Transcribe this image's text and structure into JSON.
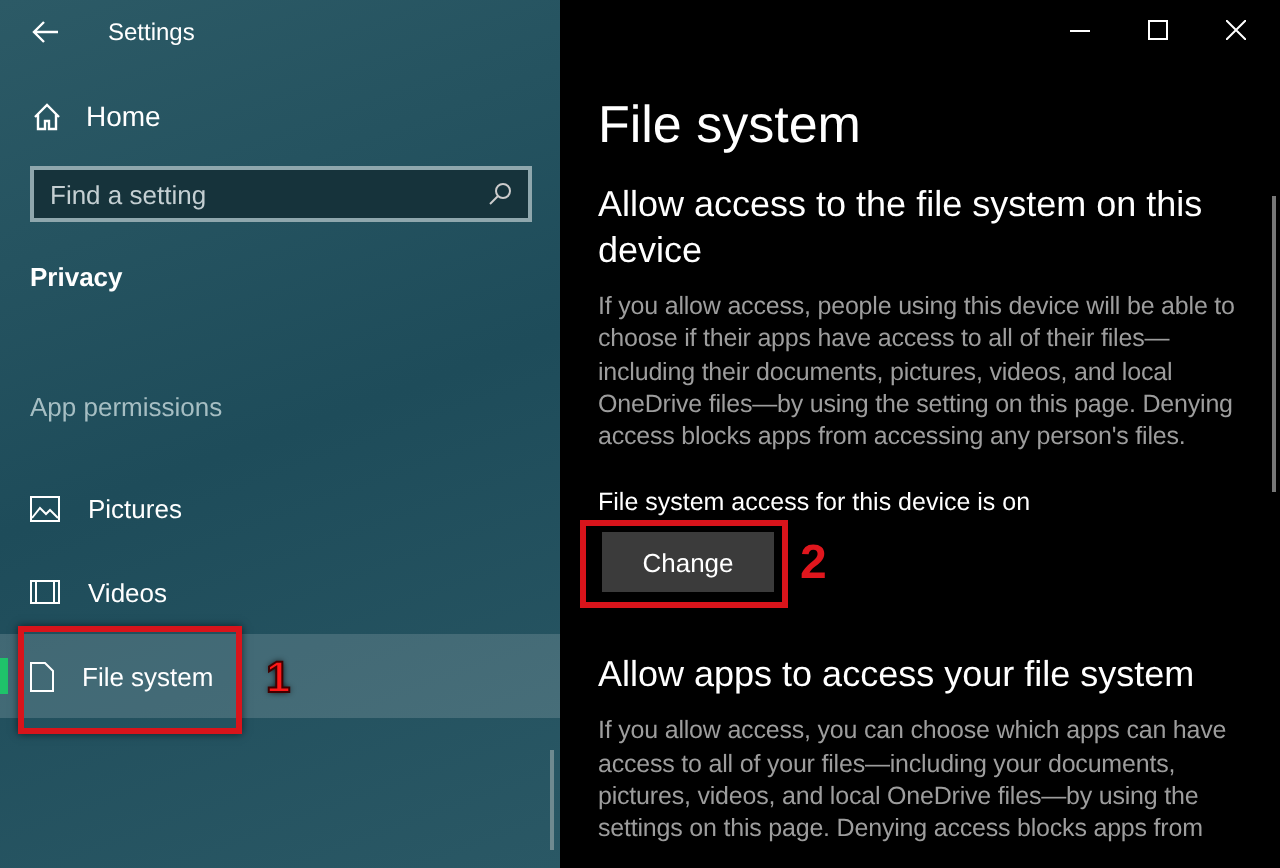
{
  "window": {
    "title": "Settings"
  },
  "sidebar": {
    "home": "Home",
    "search": {
      "placeholder": "Find a setting"
    },
    "section": "Privacy",
    "group": "App permissions",
    "items": [
      {
        "label": "Pictures",
        "kind": "pictures",
        "selected": false
      },
      {
        "label": "Videos",
        "kind": "videos",
        "selected": false
      },
      {
        "label": "File system",
        "kind": "file",
        "selected": true
      }
    ]
  },
  "page": {
    "title": "File system",
    "sections": [
      {
        "heading": "Allow access to the file system on this device",
        "text": "If you allow access, people using this device will be able to choose if their apps have access to all of their files—including their documents, pictures, videos, and local OneDrive files—by using the setting on this page. Denying access blocks apps from accessing any person's files.",
        "status": "File system access for this device is on",
        "button": "Change"
      },
      {
        "heading": "Allow apps to access your file system",
        "text": "If you allow access, you can choose which apps can have access to all of your files—including your documents, pictures, videos, and local OneDrive files—by using the settings on this page. Denying access blocks apps from"
      }
    ]
  },
  "annotations": [
    "1",
    "2"
  ]
}
